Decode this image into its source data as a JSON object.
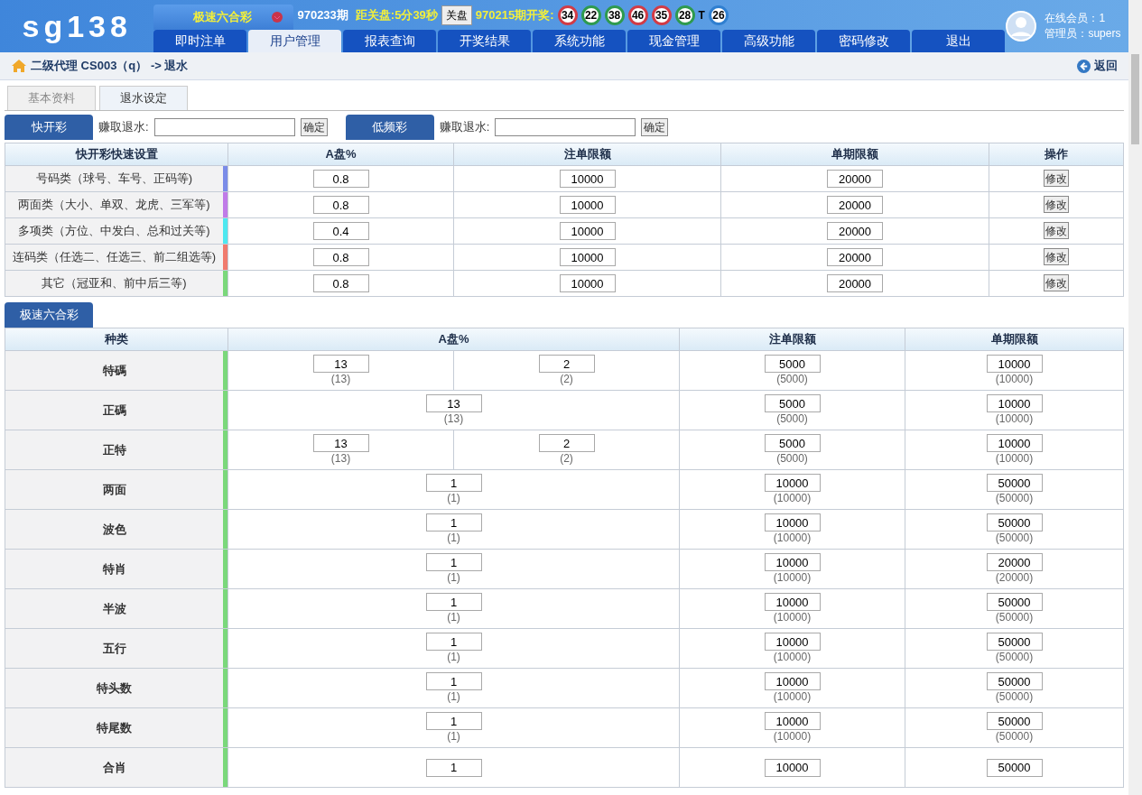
{
  "header": {
    "logo": "sg138",
    "game": "极速六合彩",
    "period": "970233期",
    "countdown": "距关盘:5分39秒",
    "close_button": "关盘",
    "last_draw": "970215期开奖:",
    "balls": [
      {
        "text": "34",
        "color": "#d23b45"
      },
      {
        "text": "22",
        "color": "#2e9a4e"
      },
      {
        "text": "38",
        "color": "#2e9a4e"
      },
      {
        "text": "46",
        "color": "#d23b45"
      },
      {
        "text": "35",
        "color": "#d23b45"
      },
      {
        "text": "28",
        "color": "#2e9a4e"
      },
      {
        "text": "T",
        "kind": "label"
      },
      {
        "text": "26",
        "color": "#2f7fd0"
      }
    ],
    "online": "在线会员：1",
    "admin": "管理员：supers"
  },
  "nav": [
    {
      "label": "即时注单",
      "selected": false
    },
    {
      "label": "用户管理",
      "selected": true
    },
    {
      "label": "报表查询",
      "selected": false
    },
    {
      "label": "开奖结果",
      "selected": false
    },
    {
      "label": "系统功能",
      "selected": false
    },
    {
      "label": "现金管理",
      "selected": false
    },
    {
      "label": "高级功能",
      "selected": false
    },
    {
      "label": "密码修改",
      "selected": false
    },
    {
      "label": "退出",
      "selected": false
    }
  ],
  "breadcrumb": "二级代理 CS003（q） -> 退水",
  "back": "返回",
  "tabs": [
    {
      "label": "基本资料",
      "selected": false
    },
    {
      "label": "退水设定",
      "selected": true
    }
  ],
  "quick": [
    {
      "label": "快开彩",
      "field_label": "赚取退水:",
      "button": "确定"
    },
    {
      "label": "低频彩",
      "field_label": "赚取退水:",
      "button": "确定"
    }
  ],
  "table1": {
    "columns": [
      "快开彩快速设置",
      "A盘%",
      "注单限额",
      "单期限额",
      "操作"
    ],
    "rows": [
      {
        "name": "号码类（球号、车号、正码等)",
        "color": "#7b8ce8",
        "a": "0.8",
        "bet": "10000",
        "period": "20000",
        "action": "修改"
      },
      {
        "name": "两面类（大小、单双、龙虎、三军等)",
        "color": "#c07be8",
        "a": "0.8",
        "bet": "10000",
        "period": "20000",
        "action": "修改"
      },
      {
        "name": "多项类（方位、中发白、总和过关等)",
        "color": "#4ee8f0",
        "a": "0.4",
        "bet": "10000",
        "period": "20000",
        "action": "修改"
      },
      {
        "name": "连码类（任选二、任选三、前二组选等)",
        "color": "#f07b6e",
        "a": "0.8",
        "bet": "10000",
        "period": "20000",
        "action": "修改"
      },
      {
        "name": "其它（冠亚和、前中后三等)",
        "color": "#7bd87b",
        "a": "0.8",
        "bet": "10000",
        "period": "20000",
        "action": "修改"
      }
    ]
  },
  "section2": "极速六合彩",
  "table2": {
    "columns": [
      "种类",
      "A盘%",
      "注单限额",
      "单期限额"
    ],
    "rows": [
      {
        "name": "特碼",
        "a": [
          {
            "value": "13",
            "default": "(13)"
          },
          {
            "value": "2",
            "default": "(2)"
          }
        ],
        "bet": {
          "value": "5000",
          "default": "(5000)"
        },
        "period": {
          "value": "10000",
          "default": "(10000)"
        }
      },
      {
        "name": "正碼",
        "a": [
          {
            "value": "13",
            "default": "(13)"
          }
        ],
        "bet": {
          "value": "5000",
          "default": "(5000)"
        },
        "period": {
          "value": "10000",
          "default": "(10000)"
        }
      },
      {
        "name": "正特",
        "a": [
          {
            "value": "13",
            "default": "(13)"
          },
          {
            "value": "2",
            "default": "(2)"
          }
        ],
        "bet": {
          "value": "5000",
          "default": "(5000)"
        },
        "period": {
          "value": "10000",
          "default": "(10000)"
        }
      },
      {
        "name": "两面",
        "a": [
          {
            "value": "1",
            "default": "(1)"
          }
        ],
        "bet": {
          "value": "10000",
          "default": "(10000)"
        },
        "period": {
          "value": "50000",
          "default": "(50000)"
        }
      },
      {
        "name": "波色",
        "a": [
          {
            "value": "1",
            "default": "(1)"
          }
        ],
        "bet": {
          "value": "10000",
          "default": "(10000)"
        },
        "period": {
          "value": "50000",
          "default": "(50000)"
        }
      },
      {
        "name": "特肖",
        "a": [
          {
            "value": "1",
            "default": "(1)"
          }
        ],
        "bet": {
          "value": "10000",
          "default": "(10000)"
        },
        "period": {
          "value": "20000",
          "default": "(20000)"
        }
      },
      {
        "name": "半波",
        "a": [
          {
            "value": "1",
            "default": "(1)"
          }
        ],
        "bet": {
          "value": "10000",
          "default": "(10000)"
        },
        "period": {
          "value": "50000",
          "default": "(50000)"
        }
      },
      {
        "name": "五行",
        "a": [
          {
            "value": "1",
            "default": "(1)"
          }
        ],
        "bet": {
          "value": "10000",
          "default": "(10000)"
        },
        "period": {
          "value": "50000",
          "default": "(50000)"
        }
      },
      {
        "name": "特头数",
        "a": [
          {
            "value": "1",
            "default": "(1)"
          }
        ],
        "bet": {
          "value": "10000",
          "default": "(10000)"
        },
        "period": {
          "value": "50000",
          "default": "(50000)"
        }
      },
      {
        "name": "特尾数",
        "a": [
          {
            "value": "1",
            "default": "(1)"
          }
        ],
        "bet": {
          "value": "10000",
          "default": "(10000)"
        },
        "period": {
          "value": "50000",
          "default": "(50000)"
        }
      },
      {
        "name": "合肖",
        "a": [
          {
            "value": "1"
          }
        ],
        "bet": {
          "value": "10000"
        },
        "period": {
          "value": "50000"
        }
      }
    ]
  }
}
